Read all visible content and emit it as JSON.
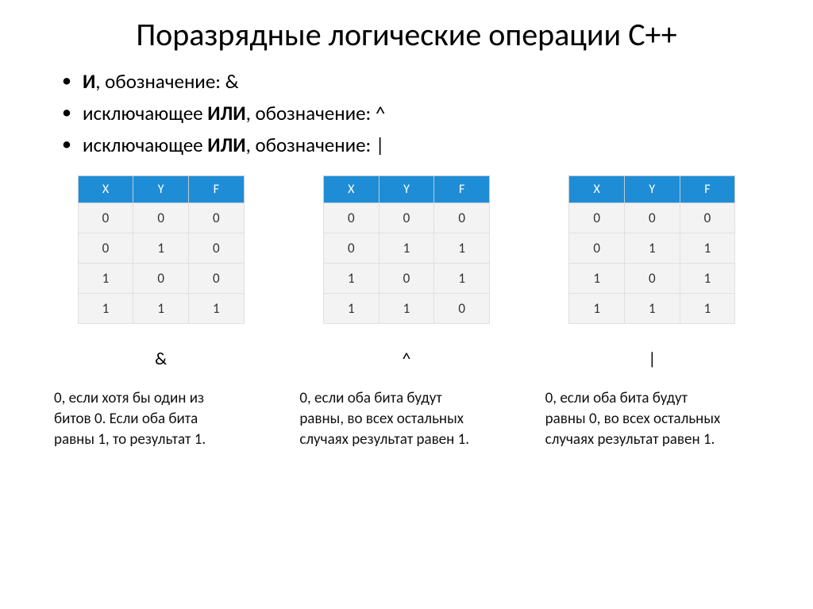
{
  "title": "Поразрядные логические операции С++",
  "bullets": [
    {
      "prefix": "",
      "bold": "И",
      "suffix": ", обозначение: &"
    },
    {
      "prefix": "исключающее ",
      "bold": "ИЛИ",
      "suffix": ", обозначение:  ^"
    },
    {
      "prefix": "исключающее ",
      "bold": "ИЛИ",
      "suffix": ", обозначение:  |"
    }
  ],
  "headers": [
    "X",
    "Y",
    "F"
  ],
  "tables": [
    {
      "symbol": "&",
      "rows": [
        [
          "0",
          "0",
          "0"
        ],
        [
          "0",
          "1",
          "0"
        ],
        [
          "1",
          "0",
          "0"
        ],
        [
          "1",
          "1",
          "1"
        ]
      ],
      "desc": "0, если хотя бы один из битов 0. Если оба бита равны 1, то результат 1."
    },
    {
      "symbol": "^",
      "rows": [
        [
          "0",
          "0",
          "0"
        ],
        [
          "0",
          "1",
          "1"
        ],
        [
          "1",
          "0",
          "1"
        ],
        [
          "1",
          "1",
          "0"
        ]
      ],
      "desc": "0, если оба бита будут равны, во всех остальных случаях результат равен 1."
    },
    {
      "symbol": "|",
      "rows": [
        [
          "0",
          "0",
          "0"
        ],
        [
          "0",
          "1",
          "1"
        ],
        [
          "1",
          "0",
          "1"
        ],
        [
          "1",
          "1",
          "1"
        ]
      ],
      "desc": "0, если оба бита будут равны 0, во всех остальных случаях результат равен 1."
    }
  ]
}
